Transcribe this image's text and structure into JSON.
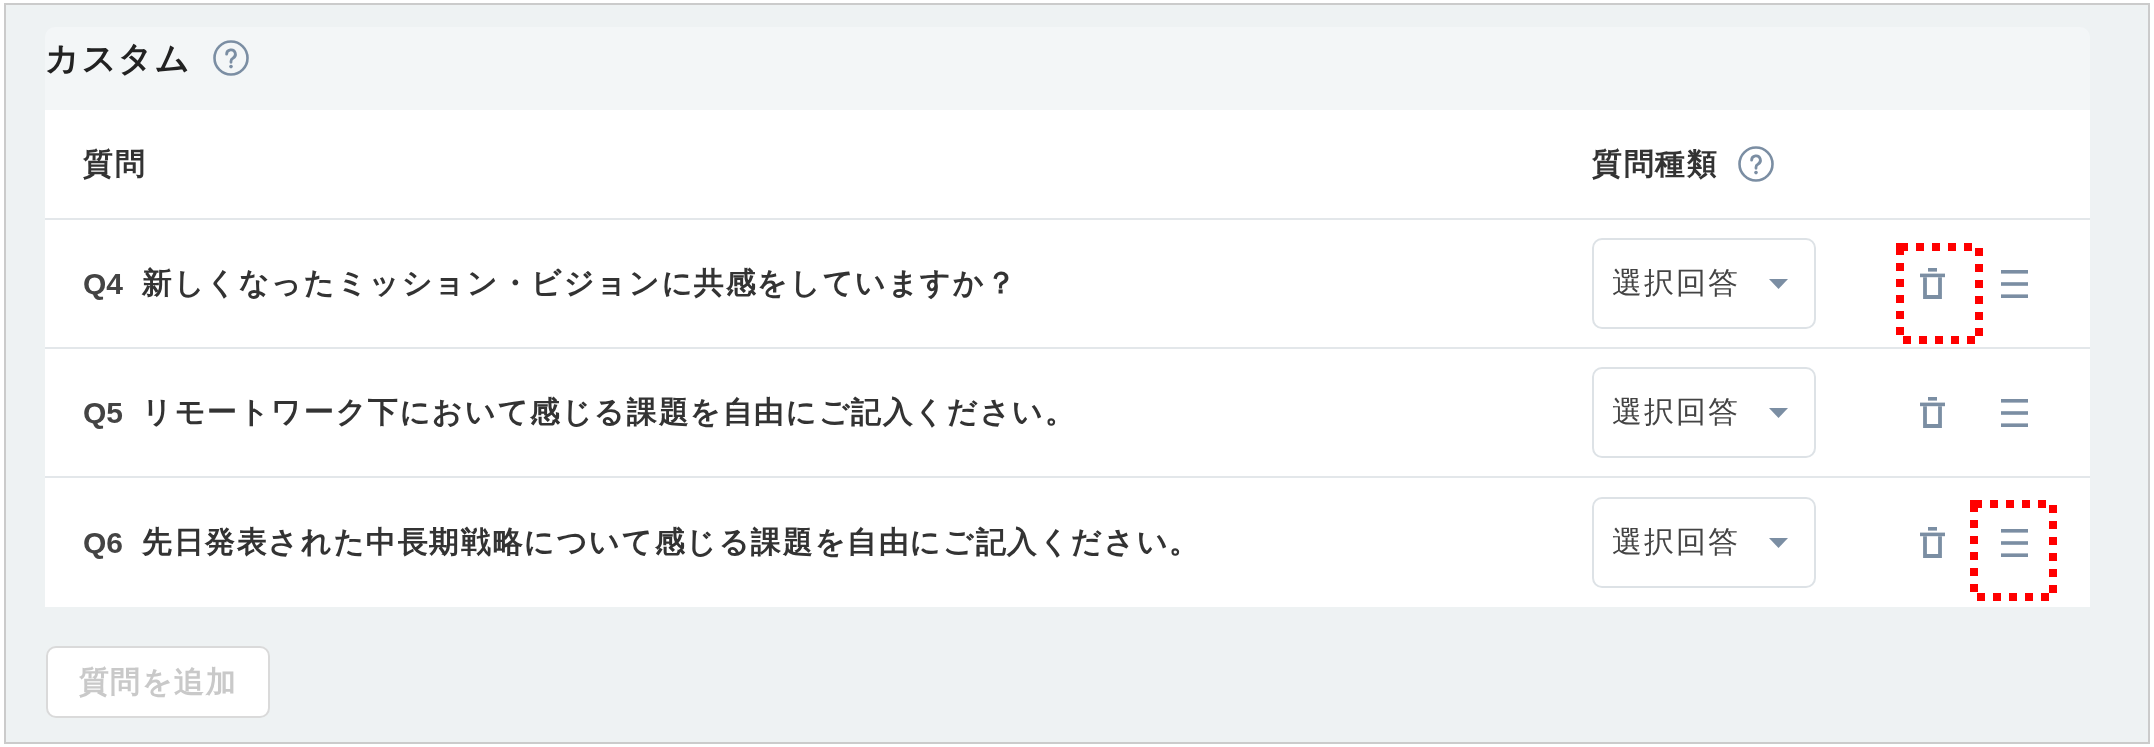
{
  "section": {
    "title": "カスタム",
    "help": true
  },
  "table": {
    "columns": [
      {
        "label": "質問",
        "help": false
      },
      {
        "label": "質問種類",
        "help": true
      }
    ],
    "rows": [
      {
        "number": "Q4",
        "question": "新しくなったミッション・ビジョンに共感をしていますか？",
        "type": "選択回答",
        "delete_highlighted": true,
        "handle_highlighted": false
      },
      {
        "number": "Q5",
        "question": "リモートワーク下において感じる課題を自由にご記入ください。",
        "type": "選択回答",
        "delete_highlighted": false,
        "handle_highlighted": false
      },
      {
        "number": "Q6",
        "question": "先日発表された中長期戦略について感じる課題を自由にご記入ください。",
        "type": "選択回答",
        "delete_highlighted": false,
        "handle_highlighted": true
      }
    ]
  },
  "add_button": {
    "label": "質問を追加",
    "disabled": true
  }
}
